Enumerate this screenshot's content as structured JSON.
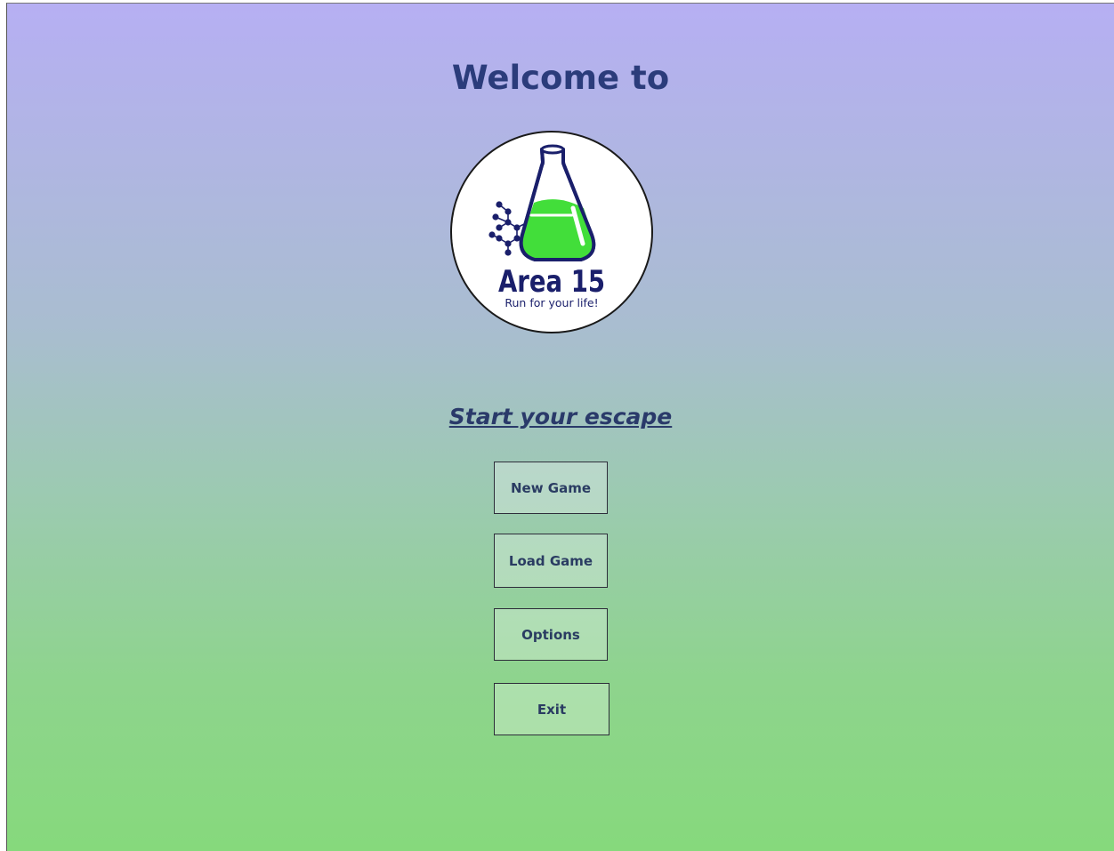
{
  "header": {
    "title": "Welcome to"
  },
  "logo": {
    "name": "Area 15",
    "tagline": "Run for your life!",
    "liquid_color": "#42de3a",
    "ink_color": "#1a1f6b"
  },
  "menu": {
    "heading": "Start your escape",
    "buttons": [
      {
        "label": "New Game"
      },
      {
        "label": "Load Game"
      },
      {
        "label": "Options"
      },
      {
        "label": "Exit"
      }
    ]
  },
  "colors": {
    "gradient_top": "#b6aff3",
    "gradient_bottom": "#86d97c",
    "title": "#2b3c7b"
  }
}
